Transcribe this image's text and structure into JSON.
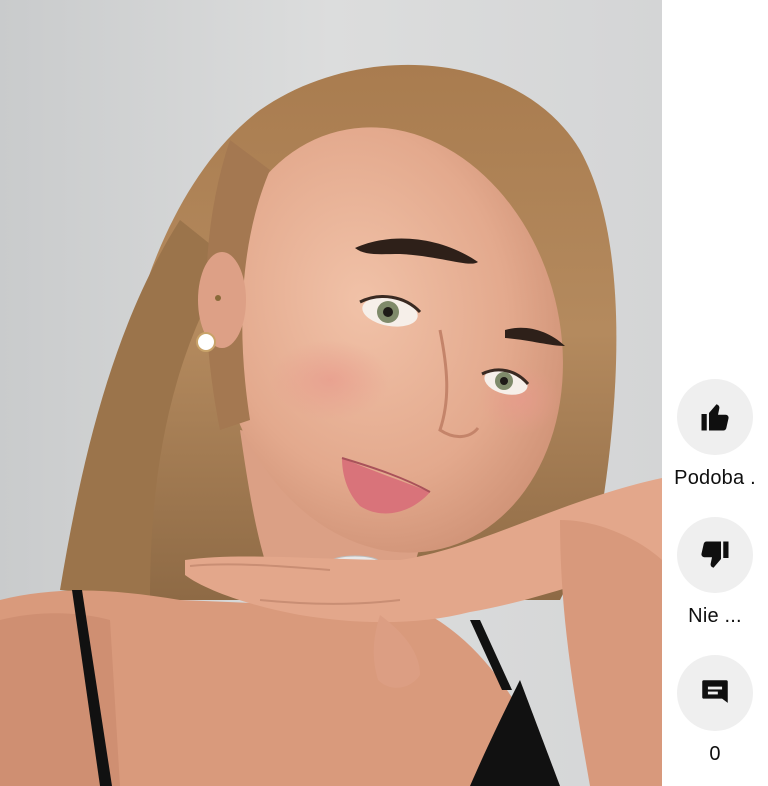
{
  "video": {
    "scene": "selfie"
  },
  "actions": {
    "like": {
      "icon": "thumbs-up-icon",
      "label": "Podoba ."
    },
    "dislike": {
      "icon": "thumbs-down-icon",
      "label": "Nie ..."
    },
    "comments": {
      "icon": "comment-icon",
      "label": "0"
    }
  },
  "colors": {
    "button_bg": "#efefef",
    "icon": "#0f0f0f",
    "text": "#0f0f0f"
  }
}
